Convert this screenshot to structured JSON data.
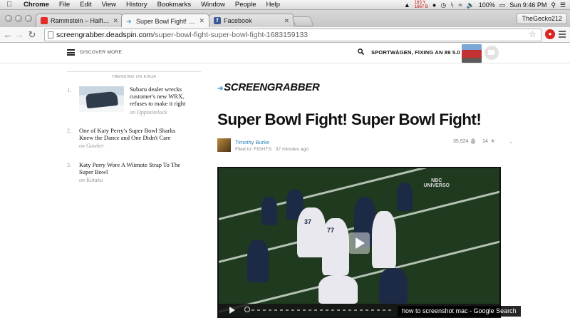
{
  "menubar": {
    "app_name": "Chrome",
    "items": [
      "File",
      "Edit",
      "View",
      "History",
      "Bookmarks",
      "Window",
      "People",
      "Help"
    ],
    "network_stat_1": "163 Y",
    "network_stat_2": "1667 B",
    "battery": "100%",
    "clock": "Sun 9:46 PM"
  },
  "tabs": [
    {
      "label": "Rammstein – Haifisch (Offi",
      "favicon": "youtube-icon",
      "color": "#e52d27",
      "active": false
    },
    {
      "label": "Super Bowl Fight! Super B",
      "favicon": "screengrabber-icon",
      "color": "#4a9fd5",
      "active": true
    },
    {
      "label": "Facebook",
      "favicon": "facebook-icon",
      "color": "#3b5998",
      "active": false
    }
  ],
  "profile_name": "TheGecko212",
  "address": {
    "host": "screengrabber.deadspin.com",
    "path": "/super-bowl-fight-super-bowl-fight-1683159133"
  },
  "header": {
    "discover": "DISCOVER MORE",
    "promo": "SPORTWÄGEN, FIXING AN 89 5.0"
  },
  "trending": {
    "heading": "TRENDING ON KINJA",
    "items": [
      {
        "num": "1.",
        "title": "Subaru dealer wrecks customer's new WRX, refuses to make it right",
        "source": "on Oppositelock"
      },
      {
        "num": "2.",
        "title": "One of Katy Perry's Super Bowl Sharks Knew the Dance and One Didn't Care",
        "source": "on Gawker"
      },
      {
        "num": "3.",
        "title": "Katy Perry Wore A Wiimote Strap To The Super Bowl",
        "source": "on Kotaku"
      }
    ]
  },
  "article": {
    "brand": "SCREENGRABBER",
    "headline": "Super Bowl Fight! Super Bowl Fight!",
    "author": "Timothy Burke",
    "filed": "Filed to: FIGHTS",
    "time": "37 minutes ago",
    "views": "35,524",
    "likes": "14"
  },
  "video": {
    "watermark_1": "NBC",
    "watermark_2": "UNIVERSO",
    "jersey_1": "77",
    "jersey_2": "37"
  },
  "toast": "how to screenshot mac - Google Search"
}
